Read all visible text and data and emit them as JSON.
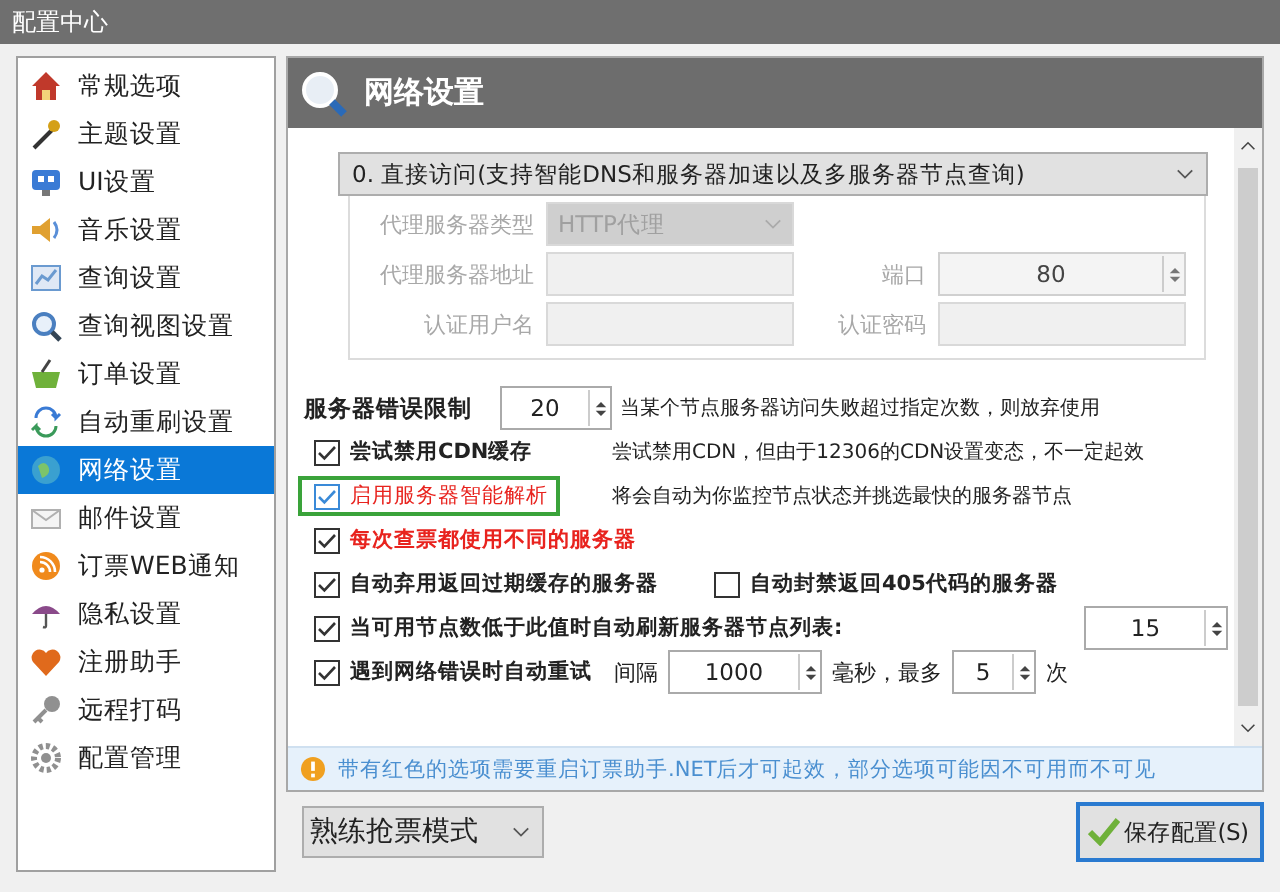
{
  "window": {
    "title": "配置中心"
  },
  "sidebar": {
    "items": [
      {
        "label": "常规选项",
        "selected": false
      },
      {
        "label": "主题设置",
        "selected": false
      },
      {
        "label": "UI设置",
        "selected": false
      },
      {
        "label": "音乐设置",
        "selected": false
      },
      {
        "label": "查询设置",
        "selected": false
      },
      {
        "label": "查询视图设置",
        "selected": false
      },
      {
        "label": "订单设置",
        "selected": false
      },
      {
        "label": "自动重刷设置",
        "selected": false
      },
      {
        "label": "网络设置",
        "selected": true
      },
      {
        "label": "邮件设置",
        "selected": false
      },
      {
        "label": "订票WEB通知",
        "selected": false
      },
      {
        "label": "隐私设置",
        "selected": false
      },
      {
        "label": "注册助手",
        "selected": false
      },
      {
        "label": "远程打码",
        "selected": false
      },
      {
        "label": "配置管理",
        "selected": false
      }
    ]
  },
  "panel": {
    "title": "网络设置",
    "mode": {
      "value": "0. 直接访问(支持智能DNS和服务器加速以及多服务器节点查询)"
    },
    "proxy": {
      "disabled": true,
      "type_label": "代理服务器类型",
      "type_value": "HTTP代理",
      "address_label": "代理服务器地址",
      "port_label": "端口",
      "port_value": "80",
      "user_label": "认证用户名",
      "password_label": "认证密码"
    },
    "options": [
      {
        "kind": "spin",
        "label": "服务器错误限制",
        "value": "20",
        "note": "当某个节点服务器访问失败超过指定次数，则放弃使用"
      },
      {
        "kind": "check",
        "label": "尝试禁用CDN缓存",
        "checked": true,
        "warn": false,
        "highlighted": false,
        "note": "尝试禁用CDN，但由于12306的CDN设置变态，不一定起效"
      },
      {
        "kind": "check",
        "label": "启用服务器智能解析",
        "checked": true,
        "warn": true,
        "highlighted": true,
        "note": "将会自动为你监控节点状态并挑选最快的服务器节点"
      },
      {
        "kind": "check",
        "label": "每次查票都使用不同的服务器",
        "checked": true,
        "warn": true,
        "highlighted": false
      },
      {
        "kind": "check",
        "label": "自动弃用返回过期缓存的服务器",
        "checked": true,
        "warn": false,
        "highlighted": false,
        "extra": {
          "label": "自动封禁返回405代码的服务器",
          "checked": false
        }
      },
      {
        "kind": "check-spin",
        "label": "当可用节点数低于此值时自动刷新服务器节点列表:",
        "checked": true,
        "value": "15"
      },
      {
        "kind": "retry",
        "label": "遇到网络错误时自动重试",
        "checked": true,
        "interval_label": "间隔",
        "interval": "1000",
        "unit": "毫秒，最多",
        "count": "5",
        "count_unit": "次"
      }
    ],
    "info": "带有红色的选项需要重启订票助手.NET后才可起效，部分选项可能因不可用而不可见"
  },
  "footer": {
    "mode": "熟练抢票模式",
    "save_button": "保存配置(S)"
  }
}
